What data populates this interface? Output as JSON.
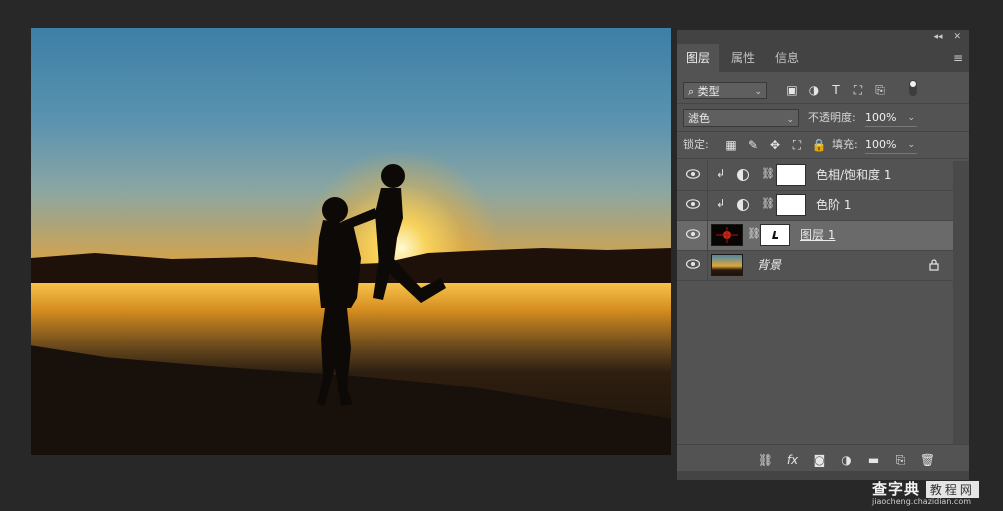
{
  "panel": {
    "topbar": {
      "collapse": "◂◂",
      "close": "✕"
    },
    "tabs": [
      "图层",
      "属性",
      "信息"
    ],
    "menu_icon": "menu-icon",
    "filter": {
      "label": "类型",
      "icons": [
        "image-filter-icon",
        "adjustment-filter-icon",
        "type-filter-icon",
        "shape-filter-icon",
        "smart-object-filter-icon"
      ]
    },
    "blend_mode": "滤色",
    "opacity_label": "不透明度:",
    "opacity_value": "100%",
    "lock_label": "锁定:",
    "lock_icons": [
      "lock-transparency-icon",
      "lock-brush-icon",
      "lock-position-icon",
      "lock-artboard-icon",
      "lock-all-icon"
    ],
    "fill_label": "填充:",
    "fill_value": "100%",
    "layers": [
      {
        "name": "色相/饱和度 1",
        "type": "adjustment",
        "clipped": true,
        "visible": true,
        "selected": false
      },
      {
        "name": "色阶 1",
        "type": "adjustment",
        "clipped": true,
        "visible": true,
        "selected": false
      },
      {
        "name": "图层 1",
        "type": "pixel-with-mask",
        "clipped": false,
        "visible": true,
        "selected": true
      },
      {
        "name": "背景",
        "type": "background",
        "clipped": false,
        "visible": true,
        "selected": false,
        "locked": true
      }
    ],
    "bottom_icons": [
      "link-layers-icon",
      "fx-icon",
      "add-mask-icon",
      "new-adjustment-icon",
      "new-group-icon",
      "new-layer-icon",
      "delete-icon"
    ],
    "fx_label": "fx"
  },
  "watermark": {
    "title": "查字典",
    "badge": "教程网",
    "url": "jiaocheng.chazidian.com"
  }
}
